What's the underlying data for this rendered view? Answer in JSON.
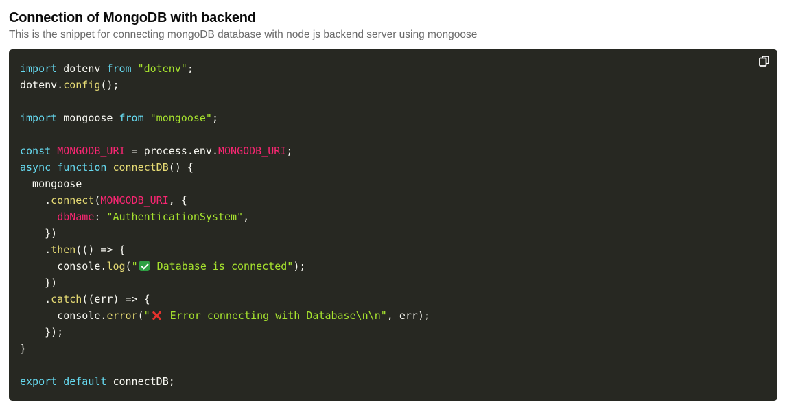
{
  "snippet": {
    "title": "Connection of MongoDB with backend",
    "description": "This is the snippet for connecting mongoDB database with node js backend server using mongoose"
  },
  "toolbar": {
    "copy_icon": "copy-icon"
  },
  "colors": {
    "panel_background": "#272822",
    "keyword": "#66d9ef",
    "string": "#a6e22e",
    "function": "#e6db74",
    "constant": "#f92672",
    "plain": "#f8f8f2"
  },
  "code": {
    "lines": [
      [
        {
          "t": "import",
          "k": "kw"
        },
        {
          "t": " dotenv ",
          "k": "plain"
        },
        {
          "t": "from",
          "k": "kw"
        },
        {
          "t": " ",
          "k": "plain"
        },
        {
          "t": "\"dotenv\"",
          "k": "str"
        },
        {
          "t": ";",
          "k": "plain"
        }
      ],
      [
        {
          "t": "dotenv.",
          "k": "plain"
        },
        {
          "t": "config",
          "k": "fn"
        },
        {
          "t": "();",
          "k": "plain"
        }
      ],
      [],
      [
        {
          "t": "import",
          "k": "kw"
        },
        {
          "t": " mongoose ",
          "k": "plain"
        },
        {
          "t": "from",
          "k": "kw"
        },
        {
          "t": " ",
          "k": "plain"
        },
        {
          "t": "\"mongoose\"",
          "k": "str"
        },
        {
          "t": ";",
          "k": "plain"
        }
      ],
      [],
      [
        {
          "t": "const",
          "k": "kw"
        },
        {
          "t": " ",
          "k": "plain"
        },
        {
          "t": "MONGODB_URI",
          "k": "const"
        },
        {
          "t": " = process.env.",
          "k": "plain"
        },
        {
          "t": "MONGODB_URI",
          "k": "const"
        },
        {
          "t": ";",
          "k": "plain"
        }
      ],
      [
        {
          "t": "async",
          "k": "kw"
        },
        {
          "t": " ",
          "k": "plain"
        },
        {
          "t": "function",
          "k": "kw"
        },
        {
          "t": " ",
          "k": "plain"
        },
        {
          "t": "connectDB",
          "k": "fn"
        },
        {
          "t": "() {",
          "k": "plain"
        }
      ],
      [
        {
          "t": "  mongoose",
          "k": "plain"
        }
      ],
      [
        {
          "t": "    .",
          "k": "plain"
        },
        {
          "t": "connect",
          "k": "fn"
        },
        {
          "t": "(",
          "k": "plain"
        },
        {
          "t": "MONGODB_URI",
          "k": "const"
        },
        {
          "t": ", {",
          "k": "plain"
        }
      ],
      [
        {
          "t": "      ",
          "k": "plain"
        },
        {
          "t": "dbName",
          "k": "const"
        },
        {
          "t": ": ",
          "k": "plain"
        },
        {
          "t": "\"AuthenticationSystem\"",
          "k": "str"
        },
        {
          "t": ",",
          "k": "plain"
        }
      ],
      [
        {
          "t": "    })",
          "k": "plain"
        }
      ],
      [
        {
          "t": "    .",
          "k": "plain"
        },
        {
          "t": "then",
          "k": "fn"
        },
        {
          "t": "(() => {",
          "k": "plain"
        }
      ],
      [
        {
          "t": "      console.",
          "k": "plain"
        },
        {
          "t": "log",
          "k": "fn"
        },
        {
          "t": "(",
          "k": "plain"
        },
        {
          "t": "\"",
          "k": "str"
        },
        {
          "t": "",
          "k": "check"
        },
        {
          "t": " Database is connected\"",
          "k": "str"
        },
        {
          "t": ");",
          "k": "plain"
        }
      ],
      [
        {
          "t": "    })",
          "k": "plain"
        }
      ],
      [
        {
          "t": "    .",
          "k": "plain"
        },
        {
          "t": "catch",
          "k": "fn"
        },
        {
          "t": "((err) => {",
          "k": "plain"
        }
      ],
      [
        {
          "t": "      console.",
          "k": "plain"
        },
        {
          "t": "error",
          "k": "fn"
        },
        {
          "t": "(",
          "k": "plain"
        },
        {
          "t": "\"",
          "k": "str"
        },
        {
          "t": "",
          "k": "cross"
        },
        {
          "t": " Error connecting with Database\\n\\n\"",
          "k": "str"
        },
        {
          "t": ", err);",
          "k": "plain"
        }
      ],
      [
        {
          "t": "    });",
          "k": "plain"
        }
      ],
      [
        {
          "t": "}",
          "k": "plain"
        }
      ],
      [],
      [
        {
          "t": "export",
          "k": "kw"
        },
        {
          "t": " ",
          "k": "plain"
        },
        {
          "t": "default",
          "k": "kw"
        },
        {
          "t": " connectDB;",
          "k": "plain"
        }
      ]
    ]
  }
}
